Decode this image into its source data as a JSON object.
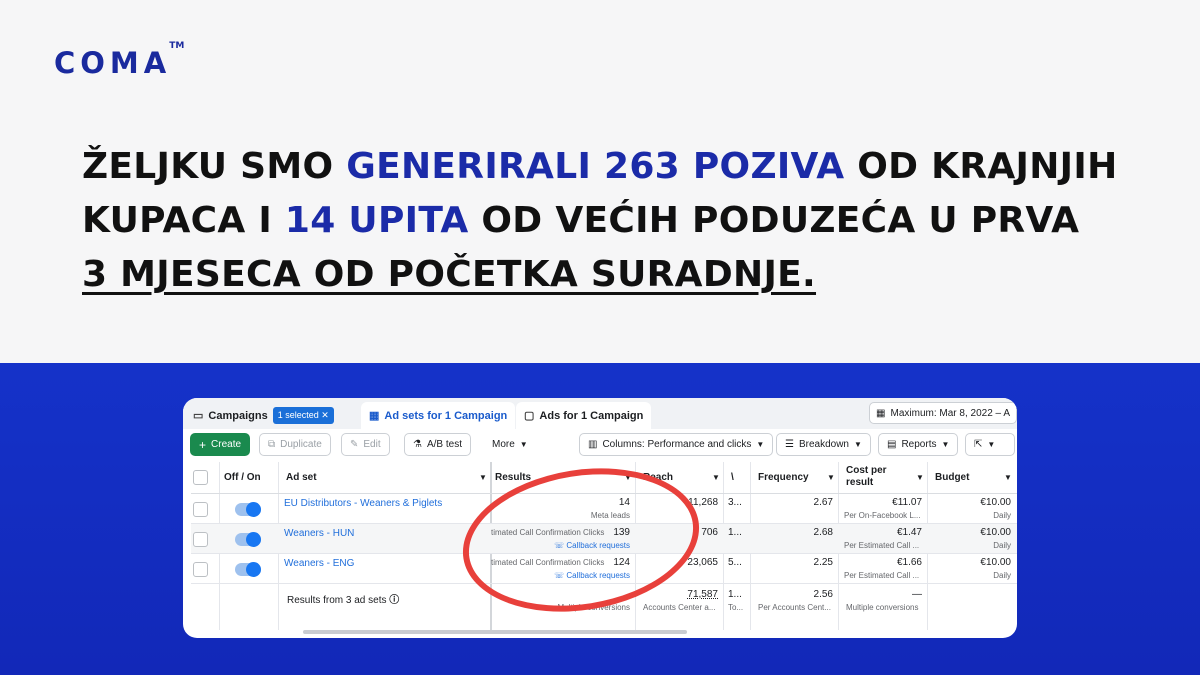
{
  "brand": {
    "logo": "COMA",
    "tm": "TM"
  },
  "headline": {
    "p1": "ŽELJKU SMO ",
    "h1": "GENERIRALI 263 POZIVA",
    "p2": " OD KRAJNJIH KUPACA I ",
    "h2": "14 UPITA",
    "p3": " OD VEĆIH PODUZEĆA U PRVA",
    "u": "3 MJESECA OD POČETKA SURADNJE."
  },
  "tabs": {
    "campaigns": "Campaigns",
    "selected": "1 selected",
    "adsets": "Ad sets for 1 Campaign",
    "ads": "Ads for 1 Campaign",
    "date": "Maximum: Mar 8, 2022 – A"
  },
  "toolbar": {
    "create": "Create",
    "duplicate": "Duplicate",
    "edit": "Edit",
    "ab": "A/B test",
    "more": "More",
    "columns": "Columns: Performance and clicks",
    "breakdown": "Breakdown",
    "reports": "Reports"
  },
  "columns": {
    "offon": "Off / On",
    "adset": "Ad set",
    "results": "Results",
    "reach": "Reach",
    "v": "\\",
    "frequency": "Frequency",
    "cost_line1": "Cost per",
    "cost_line2": "result",
    "budget": "Budget"
  },
  "rows": [
    {
      "name": "EU Distributors - Weaners & Piglets",
      "result": "14",
      "result_sub": "Meta leads",
      "result_label": "",
      "reach": "11,268",
      "v": "3...",
      "frequency": "2.67",
      "cost": "€11.07",
      "cost_sub": "Per On-Facebook L...",
      "budget": "€10.00",
      "budget_sub": "Daily"
    },
    {
      "name": "Weaners - HUN",
      "result": "139",
      "result_sub": "Callback requests",
      "result_label": "timated Call Confirmation Clicks",
      "reach": "706",
      "v": "1...",
      "frequency": "2.68",
      "cost": "€1.47",
      "cost_sub": "Per Estimated Call ...",
      "budget": "€10.00",
      "budget_sub": "Daily"
    },
    {
      "name": "Weaners - ENG",
      "result": "124",
      "result_sub": "Callback requests",
      "result_label": "timated Call Confirmation Clicks",
      "reach": "23,065",
      "v": "5...",
      "frequency": "2.25",
      "cost": "€1.66",
      "cost_sub": "Per Estimated Call ...",
      "budget": "€10.00",
      "budget_sub": "Daily"
    }
  ],
  "summary": {
    "label": "Results from 3 ad sets",
    "results_sub": "Multiple conversions",
    "reach": "71,587",
    "reach_sub": "Accounts Center a...",
    "v": "1...",
    "v_sub": "To...",
    "frequency": "2.56",
    "frequency_sub": "Per Accounts Cent...",
    "cost": "—",
    "cost_sub": "Multiple conversions"
  },
  "colors": {
    "brand_blue": "#1b2ba8",
    "background_blue": "#1532c9",
    "annotation_red": "#e8403b",
    "create_green": "#1a8a4e"
  }
}
